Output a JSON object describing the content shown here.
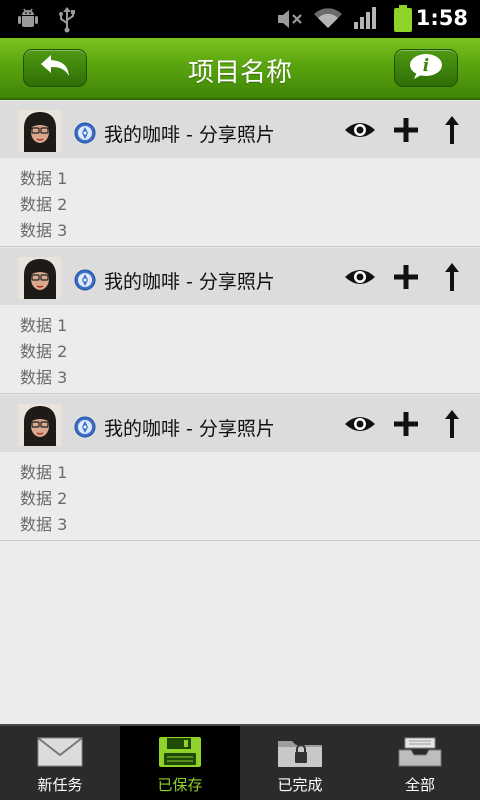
{
  "status_bar": {
    "time": "1:58",
    "icons": [
      "android-debug-icon",
      "usb-icon",
      "mute-icon",
      "wifi-icon",
      "signal-icon",
      "battery-icon"
    ]
  },
  "header": {
    "title": "项目名称",
    "back_icon": "back-arrow-icon",
    "info_icon": "info-icon",
    "accent": "#5aa510"
  },
  "items": [
    {
      "title": "我的咖啡 - 分享照片",
      "rows": [
        "数据 1",
        "数据 2",
        "数据 3"
      ]
    },
    {
      "title": "我的咖啡 - 分享照片",
      "rows": [
        "数据 1",
        "数据 2",
        "数据 3"
      ]
    },
    {
      "title": "我的咖啡 - 分享照片",
      "rows": [
        "数据 1",
        "数据 2",
        "数据 3"
      ]
    }
  ],
  "tabs": [
    {
      "label": "新任务",
      "icon": "mail-icon",
      "active": false
    },
    {
      "label": "已保存",
      "icon": "save-icon",
      "active": true
    },
    {
      "label": "已完成",
      "icon": "locked-folder-icon",
      "active": false
    },
    {
      "label": "全部",
      "icon": "inbox-tray-icon",
      "active": false
    }
  ]
}
